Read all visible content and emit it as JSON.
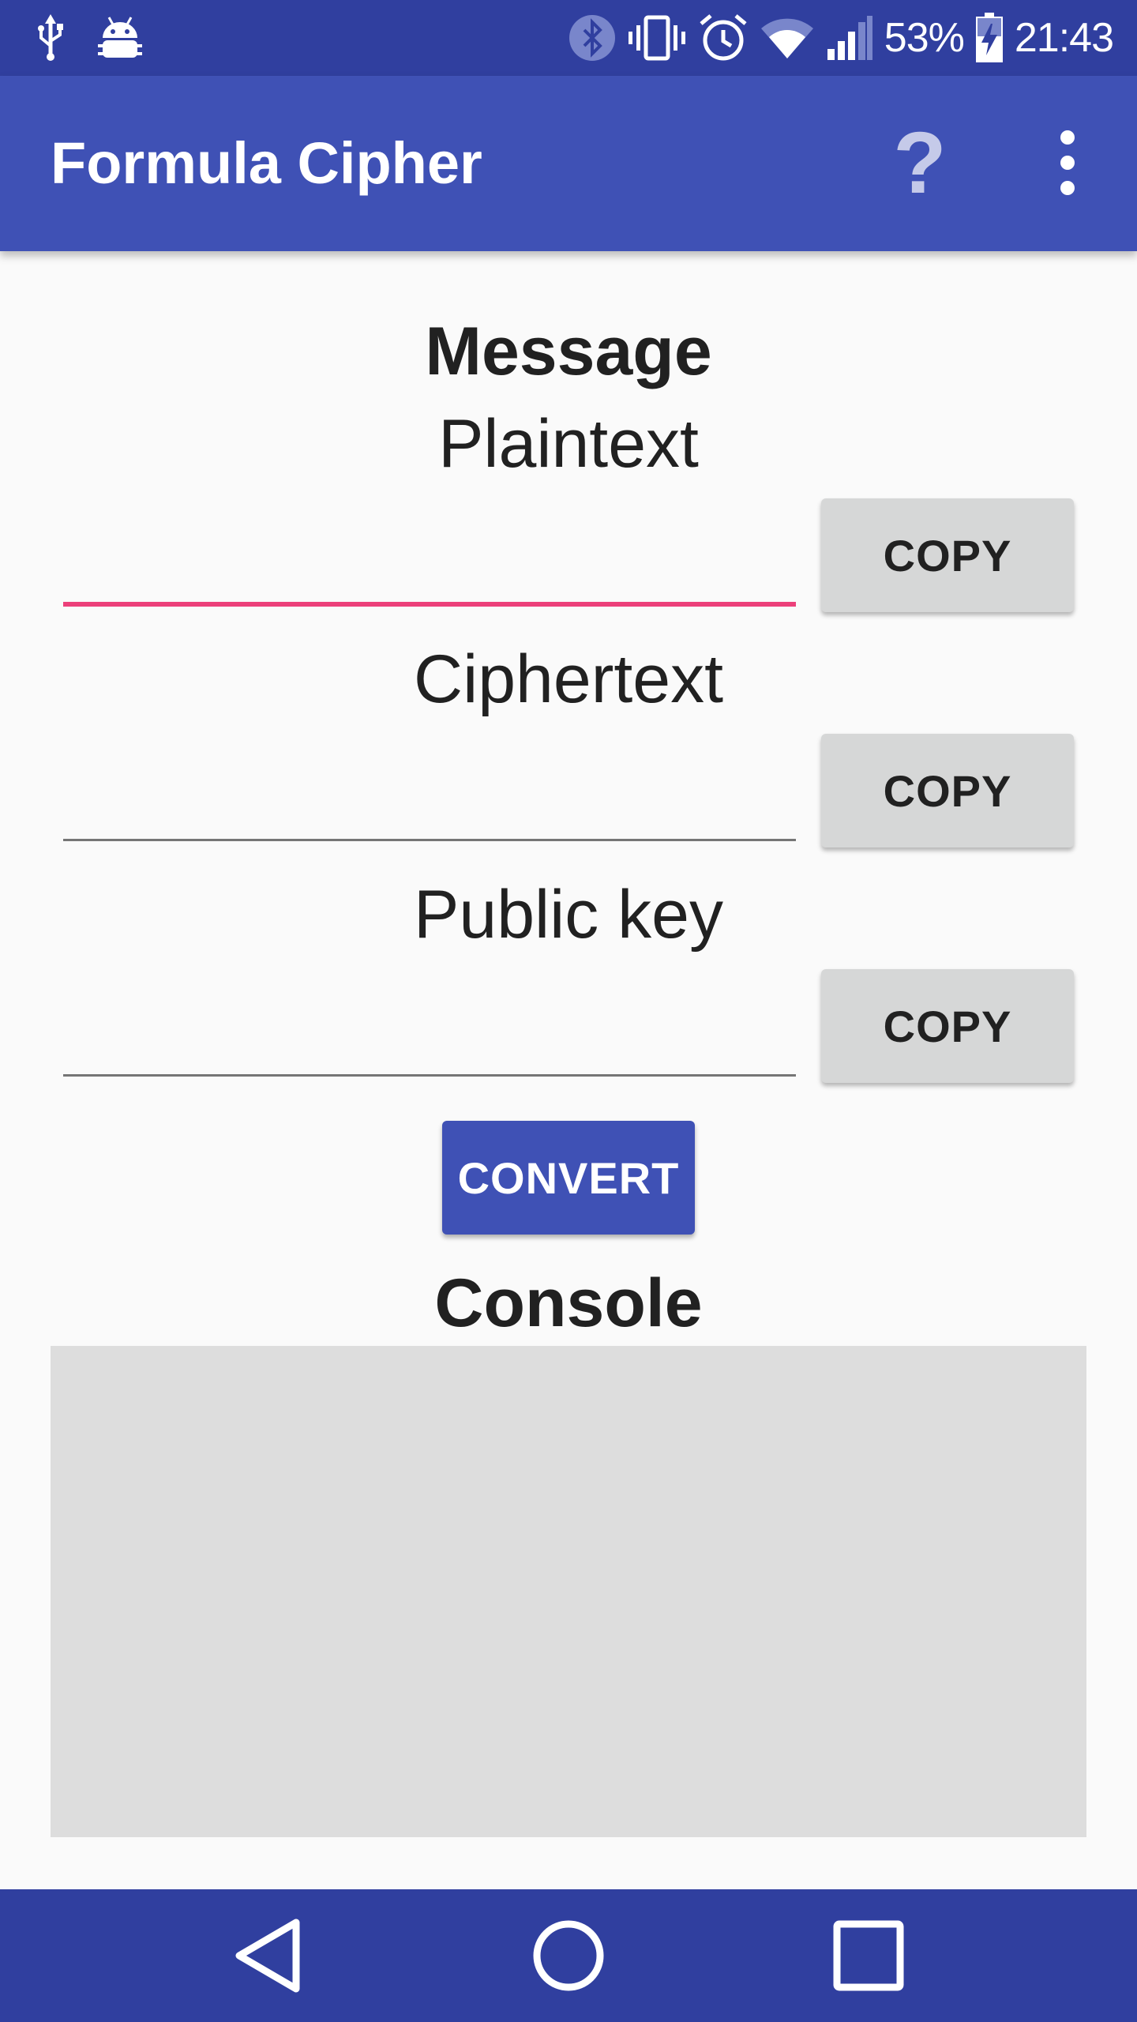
{
  "status_bar": {
    "battery_percent": "53%",
    "time": "21:43",
    "left_icons": [
      "usb-icon",
      "android-debug-icon"
    ],
    "right_icons": [
      "bluetooth-icon",
      "vibrate-icon",
      "alarm-icon",
      "wifi-icon",
      "cell-signal-icon",
      "battery-charging-icon"
    ]
  },
  "app_bar": {
    "title": "Formula Cipher",
    "help_label": "?",
    "overflow_icon": "more-vert-icon"
  },
  "message_section": {
    "heading": "Message"
  },
  "fields": [
    {
      "label": "Plaintext",
      "value": "",
      "copy_label": "COPY",
      "focused": true
    },
    {
      "label": "Ciphertext",
      "value": "",
      "copy_label": "COPY",
      "focused": false
    },
    {
      "label": "Public key",
      "value": "",
      "copy_label": "COPY",
      "focused": false
    }
  ],
  "convert_label": "CONVERT",
  "console": {
    "heading": "Console",
    "content": ""
  },
  "nav_bar": {
    "icons": [
      "back-icon",
      "home-icon",
      "recents-icon"
    ]
  },
  "colors": {
    "primary": "#3f51b5",
    "primary_dark": "#303f9f",
    "accent": "#ec407a",
    "button_gray": "#d6d7d7",
    "console_bg": "#dddddd"
  }
}
